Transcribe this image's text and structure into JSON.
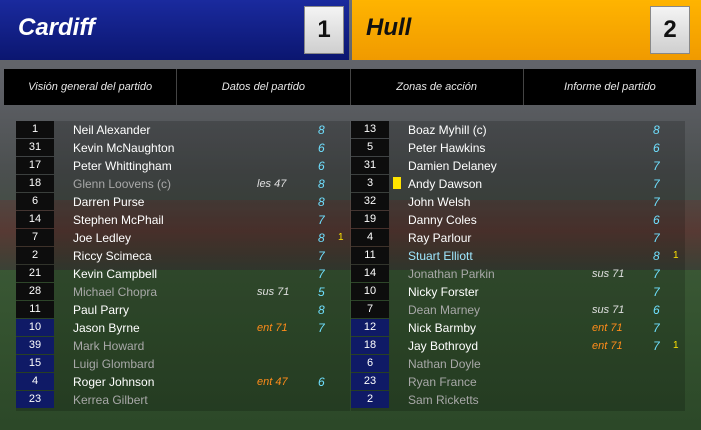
{
  "home": {
    "name": "Cardiff",
    "score": "1"
  },
  "away": {
    "name": "Hull",
    "score": "2"
  },
  "tabs": [
    "Visión general del partido",
    "Datos del partido",
    "Zonas de acción",
    "Informe del partido"
  ],
  "home_players": [
    {
      "num": "1",
      "name": "Neil Alexander",
      "note": "",
      "rating": "8",
      "yc": ""
    },
    {
      "num": "31",
      "name": "Kevin McNaughton",
      "note": "",
      "rating": "6",
      "yc": ""
    },
    {
      "num": "17",
      "name": "Peter Whittingham",
      "note": "",
      "rating": "6",
      "yc": ""
    },
    {
      "num": "18",
      "name": "Glenn Loovens (c)",
      "note": "les 47",
      "rating": "8",
      "yc": ""
    },
    {
      "num": "6",
      "name": "Darren Purse",
      "note": "",
      "rating": "8",
      "yc": ""
    },
    {
      "num": "14",
      "name": "Stephen McPhail",
      "note": "",
      "rating": "7",
      "yc": ""
    },
    {
      "num": "7",
      "name": "Joe Ledley",
      "note": "",
      "rating": "8",
      "yc": "1"
    },
    {
      "num": "2",
      "name": "Riccy Scimeca",
      "note": "",
      "rating": "7",
      "yc": ""
    },
    {
      "num": "21",
      "name": "Kevin Campbell",
      "note": "",
      "rating": "7",
      "yc": ""
    },
    {
      "num": "28",
      "name": "Michael Chopra",
      "note": "sus 71",
      "rating": "5",
      "yc": ""
    },
    {
      "num": "11",
      "name": "Paul Parry",
      "note": "",
      "rating": "8",
      "yc": ""
    },
    {
      "num": "10",
      "name": "Jason Byrne",
      "note": "ent 71",
      "rating": "7",
      "yc": ""
    },
    {
      "num": "39",
      "name": "Mark Howard",
      "note": "",
      "rating": "",
      "yc": ""
    },
    {
      "num": "15",
      "name": "Luigi Glombard",
      "note": "",
      "rating": "",
      "yc": ""
    },
    {
      "num": "4",
      "name": "Roger Johnson",
      "note": "ent 47",
      "rating": "6",
      "yc": ""
    },
    {
      "num": "23",
      "name": "Kerrea Gilbert",
      "note": "",
      "rating": "",
      "yc": ""
    }
  ],
  "away_players": [
    {
      "num": "13",
      "name": "Boaz Myhill (c)",
      "note": "",
      "rating": "8",
      "yc": ""
    },
    {
      "num": "5",
      "name": "Peter Hawkins",
      "note": "",
      "rating": "6",
      "yc": ""
    },
    {
      "num": "31",
      "name": "Damien Delaney",
      "note": "",
      "rating": "7",
      "yc": ""
    },
    {
      "num": "3",
      "name": "Andy Dawson",
      "note": "",
      "rating": "7",
      "yc": ""
    },
    {
      "num": "32",
      "name": "John Welsh",
      "note": "",
      "rating": "7",
      "yc": ""
    },
    {
      "num": "19",
      "name": "Danny Coles",
      "note": "",
      "rating": "6",
      "yc": ""
    },
    {
      "num": "4",
      "name": "Ray Parlour",
      "note": "",
      "rating": "7",
      "yc": ""
    },
    {
      "num": "11",
      "name": "Stuart Elliott",
      "note": "",
      "rating": "8",
      "yc": "1"
    },
    {
      "num": "14",
      "name": "Jonathan Parkin",
      "note": "sus 71",
      "rating": "7",
      "yc": ""
    },
    {
      "num": "10",
      "name": "Nicky Forster",
      "note": "",
      "rating": "7",
      "yc": ""
    },
    {
      "num": "7",
      "name": "Dean Marney",
      "note": "sus 71",
      "rating": "6",
      "yc": ""
    },
    {
      "num": "12",
      "name": "Nick Barmby",
      "note": "ent 71",
      "rating": "7",
      "yc": ""
    },
    {
      "num": "18",
      "name": "Jay Bothroyd",
      "note": "ent 71",
      "rating": "7",
      "yc": "1"
    },
    {
      "num": "6",
      "name": "Nathan Doyle",
      "note": "",
      "rating": "",
      "yc": ""
    },
    {
      "num": "23",
      "name": "Ryan France",
      "note": "",
      "rating": "",
      "yc": ""
    },
    {
      "num": "2",
      "name": "Sam Ricketts",
      "note": "",
      "rating": "",
      "yc": ""
    }
  ],
  "colors": {
    "home": "#0f1a80",
    "away": "#ffb400",
    "rating": "#6fe0ff",
    "sub_in": "#ff8c1a",
    "yellow_card": "#ffe400"
  }
}
